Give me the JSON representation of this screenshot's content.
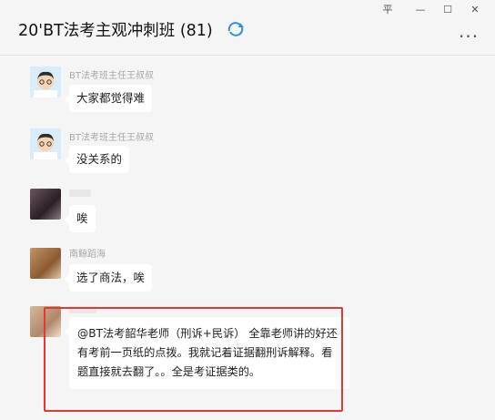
{
  "window": {
    "title": "20'BT法考主观冲刺班 (81)",
    "controls": {
      "pin": "平",
      "minimize": "—",
      "maximize": "☐",
      "close": "✕"
    },
    "more": "···"
  },
  "messages": [
    {
      "sender": "BT法考班主任王叔叔",
      "text": "大家都觉得难"
    },
    {
      "sender": "BT法考班主任王叔叔",
      "text": "没关系的"
    },
    {
      "sender": "",
      "text": "唉"
    },
    {
      "sender": "南鲸蹈海",
      "text": "选了商法，唉"
    },
    {
      "sender": "",
      "text": "@BT法考韶华老师（刑诉+民诉） 全靠老师讲的好还有考前一页纸的点拨。我就记着证据翻刑诉解释。看题直接就去翻了。。全是考证据类的。"
    }
  ],
  "colors": {
    "highlight": "#e23a30",
    "background": "#f5f5f5",
    "bubble": "#ffffff"
  }
}
